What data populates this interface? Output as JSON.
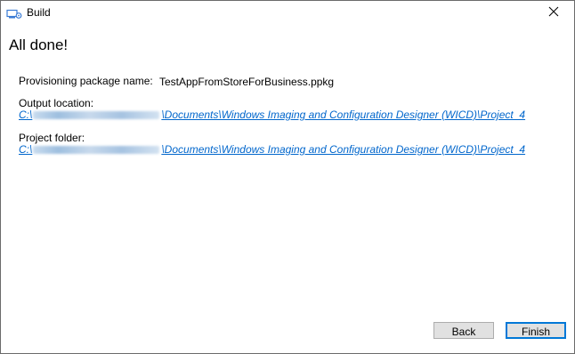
{
  "window": {
    "title": "Build"
  },
  "heading": "All done!",
  "package": {
    "label": "Provisioning package name:",
    "value": "TestAppFromStoreForBusiness.ppkg"
  },
  "output": {
    "label": "Output location:",
    "prefix": "C:\\",
    "suffix": "\\Documents\\Windows Imaging and Configuration Designer (WICD)\\Project_4"
  },
  "project": {
    "label": "Project folder:",
    "prefix": "C:\\",
    "suffix": "\\Documents\\Windows Imaging and Configuration Designer (WICD)\\Project_4"
  },
  "buttons": {
    "back": "Back",
    "finish": "Finish"
  },
  "colors": {
    "link": "#0066cc",
    "accent": "#0078d7",
    "button_face": "#e1e1e1"
  },
  "icons": {
    "app": "build-wizard-icon",
    "close": "close-icon"
  }
}
